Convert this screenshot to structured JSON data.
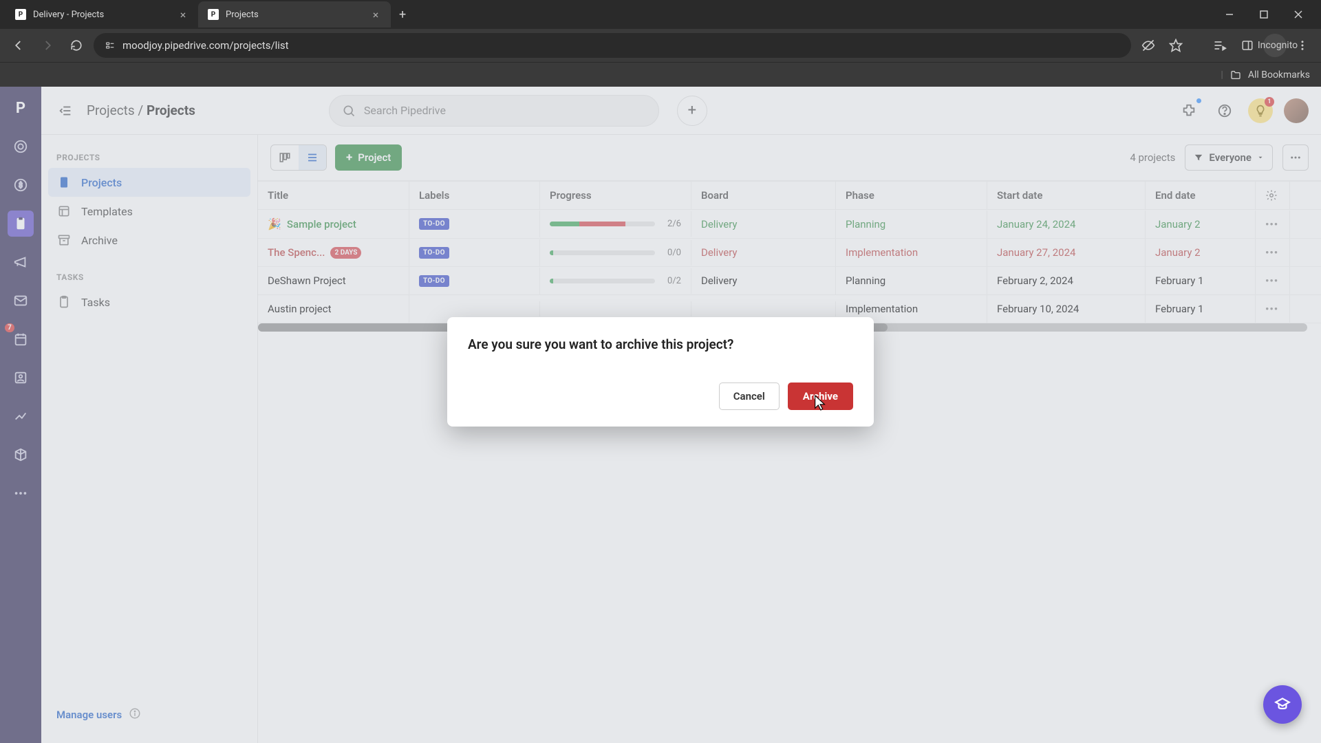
{
  "browser": {
    "tabs": [
      {
        "title": "Delivery - Projects"
      },
      {
        "title": "Projects"
      }
    ],
    "url": "moodjoy.pipedrive.com/projects/list",
    "incognito_label": "Incognito",
    "all_bookmarks": "All Bookmarks"
  },
  "topbar": {
    "breadcrumb_root": "Projects",
    "breadcrumb_leaf": "Projects",
    "search_placeholder": "Search Pipedrive"
  },
  "left_rail": {
    "badge": "7"
  },
  "sidebar": {
    "section1": "PROJECTS",
    "items1": [
      "Projects",
      "Templates",
      "Archive"
    ],
    "section2": "TASKS",
    "items2": [
      "Tasks"
    ],
    "manage_users": "Manage users"
  },
  "toolbar": {
    "new_project": "Project",
    "count": "4 projects",
    "filter": "Everyone"
  },
  "table": {
    "headers": [
      "Title",
      "Labels",
      "Progress",
      "Board",
      "Phase",
      "Start date",
      "End date"
    ],
    "rows": [
      {
        "title": "Sample project",
        "emoji": "🎉",
        "title_class": "green",
        "days": "",
        "label": "TO-DO",
        "prog_green": 28,
        "prog_red": 44,
        "prog_count": "2/6",
        "board": "Delivery",
        "board_class": "link-green",
        "phase": "Planning",
        "phase_class": "link-green",
        "start": "January 24, 2024",
        "start_class": "link-green",
        "end": "January 2",
        "end_class": "link-green"
      },
      {
        "title": "The Spenc...",
        "emoji": "",
        "title_class": "red",
        "days": "2 DAYS",
        "label": "TO-DO",
        "prog_green": 3,
        "prog_red": 0,
        "prog_count": "0/0",
        "board": "Delivery",
        "board_class": "link-red",
        "phase": "Implementation",
        "phase_class": "link-red",
        "start": "January 27, 2024",
        "start_class": "link-red",
        "end": "January 2",
        "end_class": "link-red"
      },
      {
        "title": "DeShawn Project",
        "emoji": "",
        "title_class": "",
        "days": "",
        "label": "TO-DO",
        "prog_green": 3,
        "prog_red": 0,
        "prog_count": "0/2",
        "board": "Delivery",
        "board_class": "",
        "phase": "Planning",
        "phase_class": "",
        "start": "February 2, 2024",
        "start_class": "",
        "end": "February 1",
        "end_class": ""
      },
      {
        "title": "Austin project",
        "emoji": "",
        "title_class": "",
        "days": "",
        "label": "",
        "prog_green": 0,
        "prog_red": 0,
        "prog_count": "",
        "board": "",
        "board_class": "",
        "phase": "Implementation",
        "phase_class": "",
        "start": "February 10, 2024",
        "start_class": "",
        "end": "February 1",
        "end_class": ""
      }
    ]
  },
  "modal": {
    "title": "Are you sure you want to archive this project?",
    "cancel": "Cancel",
    "archive": "Archive"
  }
}
